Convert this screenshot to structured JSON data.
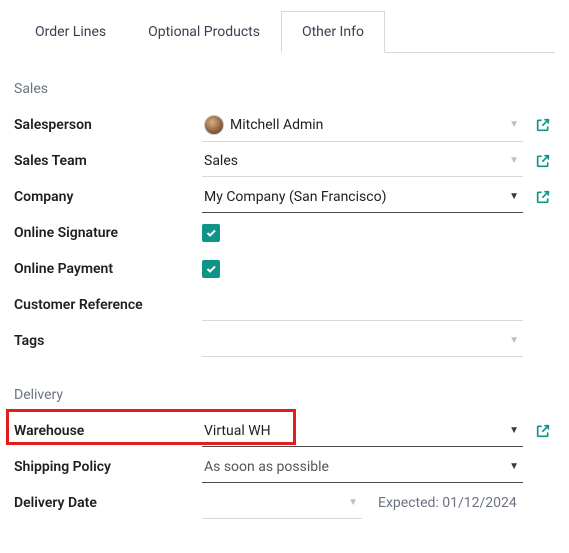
{
  "tabs": {
    "order_lines": "Order Lines",
    "optional_products": "Optional Products",
    "other_info": "Other Info"
  },
  "sections": {
    "sales": "Sales",
    "delivery": "Delivery"
  },
  "labels": {
    "salesperson": "Salesperson",
    "sales_team": "Sales Team",
    "company": "Company",
    "online_signature": "Online Signature",
    "online_payment": "Online Payment",
    "customer_reference": "Customer Reference",
    "tags": "Tags",
    "warehouse": "Warehouse",
    "shipping_policy": "Shipping Policy",
    "delivery_date": "Delivery Date"
  },
  "values": {
    "salesperson": "Mitchell Admin",
    "sales_team": "Sales",
    "company": "My Company (San Francisco)",
    "online_signature_checked": true,
    "online_payment_checked": true,
    "customer_reference": "",
    "tags": "",
    "warehouse": "Virtual WH",
    "shipping_policy": "As soon as possible",
    "delivery_date": "",
    "expected_label": "Expected: 01/12/2024"
  }
}
